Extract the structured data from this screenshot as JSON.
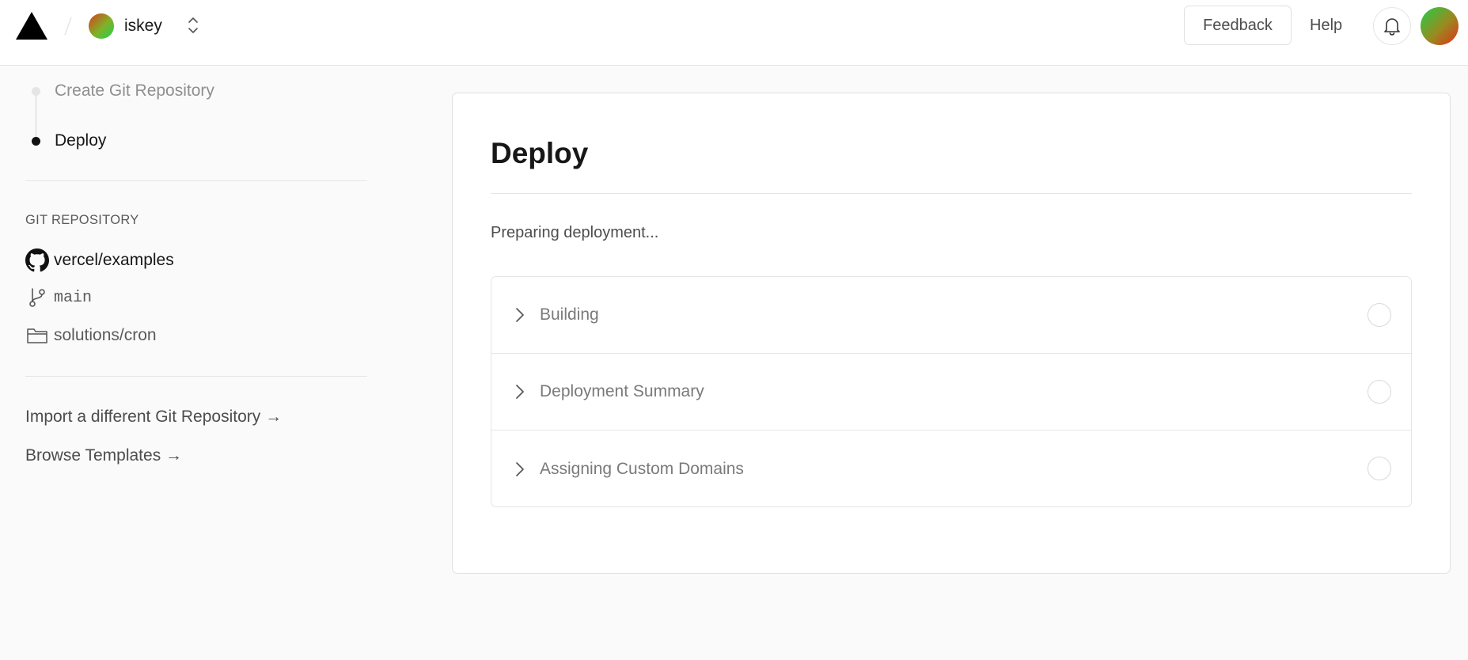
{
  "header": {
    "team_name": "iskey",
    "feedback_label": "Feedback",
    "help_label": "Help"
  },
  "sidebar": {
    "steps": [
      {
        "label": "Create Git Repository",
        "state": "completed"
      },
      {
        "label": "Deploy",
        "state": "current"
      }
    ],
    "git_section_title": "GIT REPOSITORY",
    "repo": "vercel/examples",
    "branch": "main",
    "directory": "solutions/cron",
    "links": [
      {
        "label": "Import a different Git Repository →"
      },
      {
        "label": "Browse Templates →"
      }
    ]
  },
  "main": {
    "title": "Deploy",
    "status_text": "Preparing deployment...",
    "steps": [
      {
        "label": "Building"
      },
      {
        "label": "Deployment Summary"
      },
      {
        "label": "Assigning Custom Domains"
      }
    ]
  },
  "icons": {
    "logo": "vercel-triangle-icon",
    "switcher": "chevron-up-down-icon",
    "bell": "bell-icon",
    "github": "github-icon",
    "branch": "git-branch-icon",
    "folder": "folder-icon",
    "chevron": "chevron-right-icon"
  }
}
